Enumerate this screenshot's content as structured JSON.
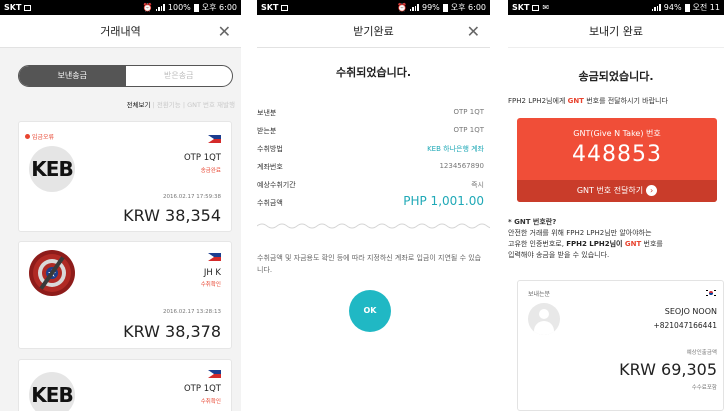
{
  "colors": {
    "accent_red": "#e8442f",
    "teal": "#20a9b7",
    "gnt_red": "#f04e38",
    "status_bar": "#000000"
  },
  "screen1": {
    "status": {
      "carrier": "SKT",
      "battery": "100%",
      "time": "오후 6:00"
    },
    "title": "거래내역",
    "close_icon": "close-icon",
    "tabs": {
      "sent": "보낸송금",
      "received": "받은송금"
    },
    "filters": {
      "all": "전체보기",
      "rest": "| 전환기능 | GNT 번호 재발행"
    },
    "cards": [
      {
        "badge": "입금오류",
        "avatar": "KEB",
        "name": "OTP 1QT",
        "status": "송금완료",
        "date": "2016.02.17 17:59:38",
        "amount": "KRW 38,354"
      },
      {
        "badge": "",
        "avatar": "shield",
        "name": "JH K",
        "status": "수취확인",
        "date": "2016.02.17 13:28:13",
        "amount": "KRW 38,378"
      },
      {
        "badge": "",
        "avatar": "KEB",
        "name": "OTP 1QT",
        "status": "수취확인",
        "date": "",
        "amount": ""
      }
    ]
  },
  "screen2": {
    "status": {
      "carrier": "SKT",
      "battery": "99%",
      "time": "오후 6:00"
    },
    "title": "받기완료",
    "heading": "수취되었습니다.",
    "rows": [
      {
        "key": "보낸분",
        "value": "OTP 1QT"
      },
      {
        "key": "받는분",
        "value": "OTP 1QT"
      },
      {
        "key": "수취방법",
        "value": "KEB 하나은행 계좌"
      },
      {
        "key": "계좌번호",
        "value": "1234567890"
      },
      {
        "key": "예상수취기간",
        "value": "즉시"
      },
      {
        "key": "수취금액",
        "value": "PHP 1,001.00"
      }
    ],
    "notice": "수취금액 및 자금용도 확인 등에 따라 지정하신 계좌로 입금이 지연될 수 있습니다.",
    "ok": "OK"
  },
  "screen3": {
    "status": {
      "carrier": "SKT",
      "battery": "94%",
      "time": "오전 11"
    },
    "title": "보내기 완료",
    "heading": "송금되었습니다.",
    "sub": {
      "pre": "FPH2 LPH2님에게 ",
      "gnt": "GNT",
      "post": " 번호를 전달하시기 바랍니다"
    },
    "gnt_label": "GNT(Give N Take) 번호",
    "gnt_code": "448853",
    "gnt_button": "GNT 번호 전달하기",
    "question": "* GNT 번호란?",
    "explain": {
      "l1": "안전한 거래를 위해 FPH2 LPH2님만 알아야하는",
      "l2a": "고유한 인증번호로, ",
      "l2b": "FPH2 LPH2님이 ",
      "l2c": "GNT",
      "l2d": " 번호를",
      "l3": "입력해야 송금을 받을 수 있습니다."
    },
    "card": {
      "label": "보내는분",
      "name": "SEOJO NOON",
      "phone": "+821047166441",
      "expected_label": "예상인출금액",
      "amount": "KRW 69,305",
      "fee_label": "수수료포함"
    }
  }
}
